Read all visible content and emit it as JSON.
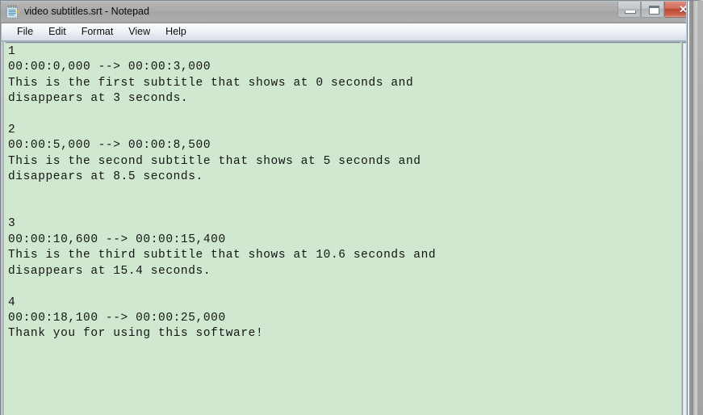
{
  "window": {
    "title": "video subtitles.srt - Notepad",
    "icon": "notepad-icon",
    "controls": {
      "minimize": "minimize",
      "maximize": "maximize",
      "close": "✕"
    }
  },
  "menu": {
    "items": [
      {
        "label": "File"
      },
      {
        "label": "Edit"
      },
      {
        "label": "Format"
      },
      {
        "label": "View"
      },
      {
        "label": "Help"
      }
    ]
  },
  "editor": {
    "background_color": "#cfe8cf",
    "text_color": "#141414",
    "content": "1\n00:00:0,000 --> 00:00:3,000\nThis is the first subtitle that shows at 0 seconds and\ndisappears at 3 seconds.\n\n2\n00:00:5,000 --> 00:00:8,500\nThis is the second subtitle that shows at 5 seconds and\ndisappears at 8.5 seconds.\n\n\n3\n00:00:10,600 --> 00:00:15,400\nThis is the third subtitle that shows at 10.6 seconds and\ndisappears at 15.4 seconds.\n\n4\n00:00:18,100 --> 00:00:25,000\nThank you for using this software!",
    "subtitles": [
      {
        "index": "1",
        "start": "00:00:0,000",
        "arrow": "-->",
        "end": "00:00:3,000",
        "lines": [
          "This is the first subtitle that shows at 0 seconds and",
          "disappears at 3 seconds."
        ]
      },
      {
        "index": "2",
        "start": "00:00:5,000",
        "arrow": "-->",
        "end": "00:00:8,500",
        "lines": [
          "This is the second subtitle that shows at 5 seconds and",
          "disappears at 8.5 seconds."
        ]
      },
      {
        "index": "3",
        "start": "00:00:10,600",
        "arrow": "-->",
        "end": "00:00:15,400",
        "lines": [
          "This is the third subtitle that shows at 10.6 seconds and",
          "disappears at 15.4 seconds."
        ]
      },
      {
        "index": "4",
        "start": "00:00:18,100",
        "arrow": "-->",
        "end": "00:00:25,000",
        "lines": [
          "Thank you for using this software!"
        ]
      }
    ]
  },
  "scrollbar": {
    "up_arrow": "scroll-up-arrow",
    "position": "top"
  }
}
